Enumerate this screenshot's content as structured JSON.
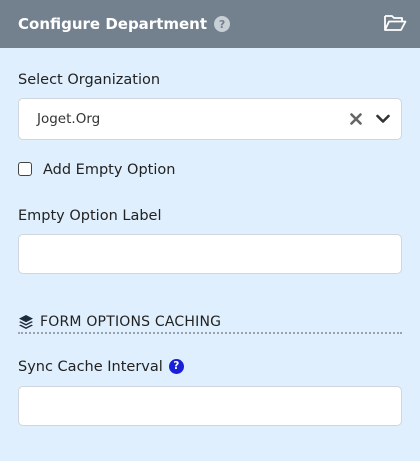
{
  "header": {
    "title": "Configure Department",
    "help_glyph": "?",
    "folder_icon": "folder-open-icon"
  },
  "organization": {
    "label": "Select Organization",
    "selected_value": "Joget.Org",
    "clear_icon": "close-icon",
    "arrow_icon": "chevron-down-icon"
  },
  "empty_option": {
    "label": "Add Empty Option",
    "checked": false
  },
  "empty_option_label": {
    "label": "Empty Option Label",
    "value": ""
  },
  "caching": {
    "title": "FORM OPTIONS CACHING",
    "icon": "layers-icon"
  },
  "sync_cache": {
    "label": "Sync Cache Interval",
    "info_glyph": "?",
    "value": ""
  },
  "colors": {
    "header_bg": "#73818e",
    "panel_bg": "#dfeffd",
    "info_blue": "#1a1fd8"
  }
}
